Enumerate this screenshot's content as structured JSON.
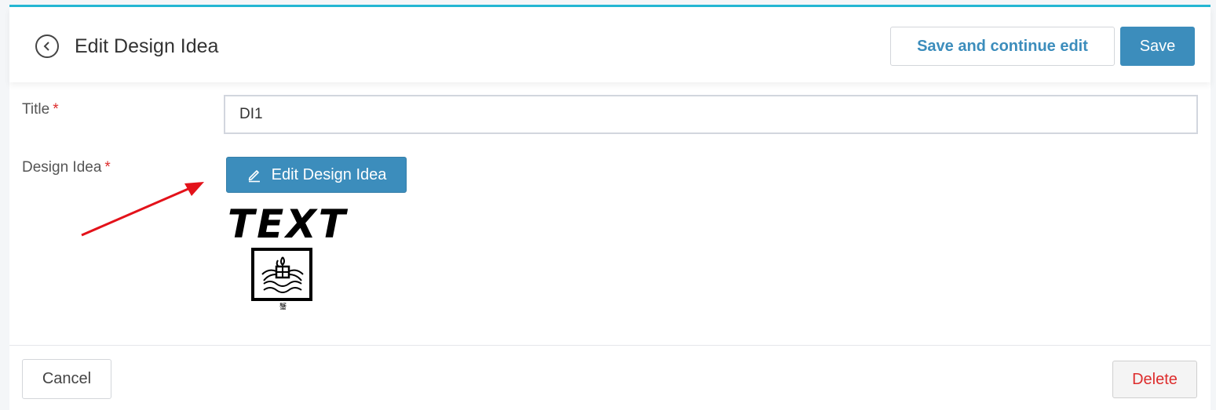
{
  "header": {
    "title": "Edit Design Idea",
    "save_continue_label": "Save and continue edit",
    "save_label": "Save"
  },
  "form": {
    "title_label": "Title",
    "title_value": "DI1",
    "design_idea_label": "Design Idea",
    "required_mark": "*",
    "edit_design_idea_label": "Edit Design Idea",
    "preview_text": "TEXT",
    "seal_caption": "蟹"
  },
  "footer": {
    "cancel_label": "Cancel",
    "delete_label": "Delete"
  },
  "colors": {
    "accent": "#3c8dbc",
    "top_border": "#25b7d3",
    "danger": "#dd2c2c",
    "annotation_arrow": "#e3121a"
  },
  "icons": {
    "back": "back-arrow-circle-icon",
    "edit": "pencil-icon"
  }
}
